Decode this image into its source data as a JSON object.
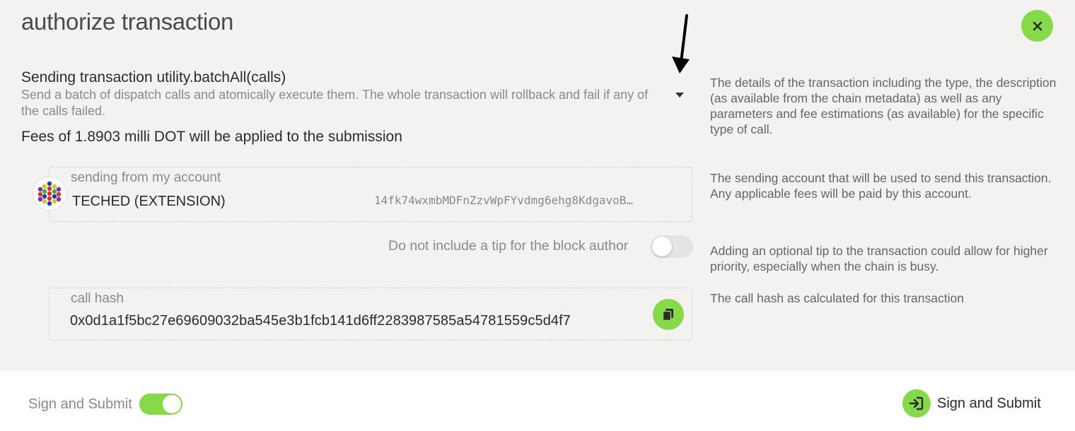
{
  "modal": {
    "title": "authorize transaction",
    "close_icon": "close-icon"
  },
  "transaction": {
    "title": "Sending transaction utility.batchAll(calls)",
    "description": "Send a batch of dispatch calls and atomically execute them. The whole transaction will rollback and fail if any of the calls failed.",
    "fees": "Fees of 1.8903 milli DOT will be applied to the submission",
    "help": "The details of the transaction including the type, the description (as available from the chain metadata) as well as any parameters and fee estimations (as available) for the specific type of call."
  },
  "account": {
    "label": "sending from my account",
    "name": "TECHED (EXTENSION)",
    "address": "14fk74wxmbMDFnZzvWpFYvdmg6ehg8KdgavoB…",
    "help": "The sending account that will be used to send this transaction. Any applicable fees will be paid by this account."
  },
  "tip": {
    "label": "Do not include a tip for the block author",
    "enabled": false,
    "help": "Adding an optional tip to the transaction could allow for higher priority, especially when the chain is busy."
  },
  "call_hash": {
    "label": "call hash",
    "value": "0x0d1a1f5bc27e69609032ba545e3b1fcb141d6ff2283987585a54781559c5d4f7",
    "help": "The call hash as calculated for this transaction",
    "copy_icon": "copy-icon"
  },
  "footer": {
    "toggle_label": "Sign and Submit",
    "toggle_enabled": true,
    "submit_label": "Sign and Submit",
    "submit_icon": "sign-in-icon"
  },
  "colors": {
    "accent": "#86d948",
    "background": "#f3f2f1",
    "footer_background": "#ffffff"
  }
}
